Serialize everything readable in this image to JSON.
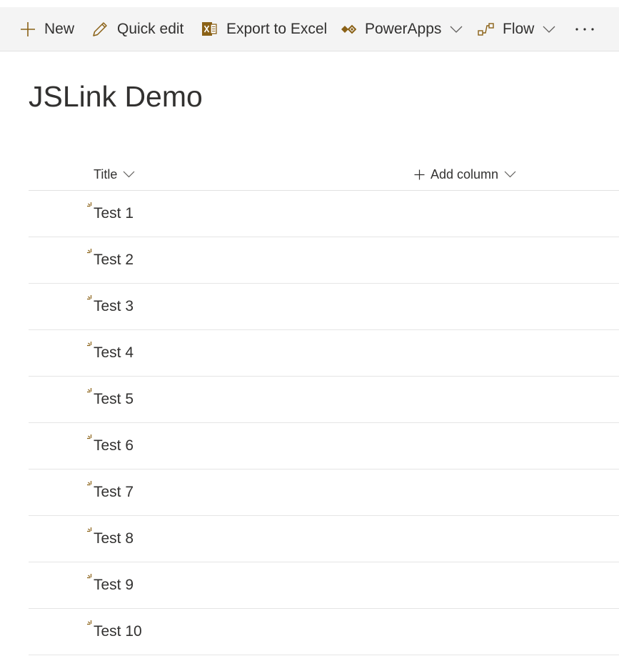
{
  "theme": {
    "accent": "#8a6116",
    "text": "#323130",
    "toolbar_bg": "#f4f4f4",
    "divider": "#e1e1e1"
  },
  "toolbar": {
    "new_label": "New",
    "new_icon": "plus-icon",
    "quick_edit_label": "Quick edit",
    "quick_edit_icon": "pencil-icon",
    "export_label": "Export to Excel",
    "export_icon": "excel-icon",
    "powerapps_label": "PowerApps",
    "powerapps_icon": "powerapps-icon",
    "flow_label": "Flow",
    "flow_icon": "flow-icon",
    "more_icon": "more-ellipsis-icon"
  },
  "page": {
    "title": "JSLink Demo"
  },
  "list": {
    "columns": [
      {
        "label": "Title"
      },
      {
        "label": "Add column"
      }
    ],
    "rows": [
      {
        "title": "Test 1"
      },
      {
        "title": "Test 2"
      },
      {
        "title": "Test 3"
      },
      {
        "title": "Test 4"
      },
      {
        "title": "Test 5"
      },
      {
        "title": "Test 6"
      },
      {
        "title": "Test 7"
      },
      {
        "title": "Test 8"
      },
      {
        "title": "Test 9"
      },
      {
        "title": "Test 10"
      }
    ]
  }
}
